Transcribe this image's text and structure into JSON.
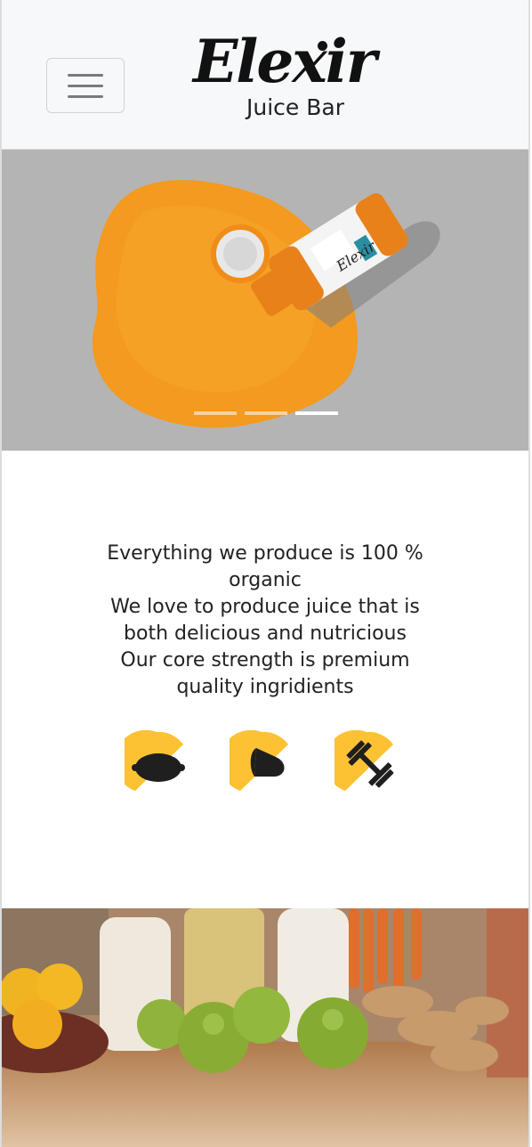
{
  "header": {
    "menu_icon": "hamburger-icon",
    "logo_title": "Elexir",
    "logo_subtitle": "Juice Bar"
  },
  "carousel": {
    "slide_count": 3,
    "active_index": 2
  },
  "about": {
    "lines": [
      "Everything we produce is 100 %",
      "organic",
      "We love to produce juice that is",
      "both delicious and nutricious",
      "Our core strength is premium",
      "quality ingridients"
    ]
  },
  "features": [
    {
      "icon": "lemon-icon"
    },
    {
      "icon": "heart-icon"
    },
    {
      "icon": "dumbbell-icon"
    }
  ],
  "colors": {
    "accent": "#fcc233",
    "icon_dark": "#1f1f1f",
    "nav_bg": "#f7f8f9"
  }
}
